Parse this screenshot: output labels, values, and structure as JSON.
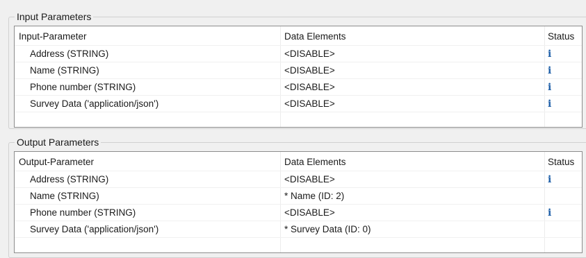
{
  "input_section": {
    "title": "Input Parameters",
    "headers": {
      "param": "Input-Parameter",
      "data": "Data Elements",
      "status": "Status"
    },
    "rows": [
      {
        "param": "Address (STRING)",
        "data": "<DISABLE>",
        "status": "i"
      },
      {
        "param": "Name (STRING)",
        "data": "<DISABLE>",
        "status": "i"
      },
      {
        "param": "Phone number (STRING)",
        "data": "<DISABLE>",
        "status": "i"
      },
      {
        "param": "Survey Data ('application/json')",
        "data": "<DISABLE>",
        "status": "i"
      }
    ]
  },
  "output_section": {
    "title": "Output Parameters",
    "headers": {
      "param": "Output-Parameter",
      "data": "Data Elements",
      "status": "Status"
    },
    "rows": [
      {
        "param": "Address (STRING)",
        "data": "<DISABLE>",
        "status": "i"
      },
      {
        "param": "Name (STRING)",
        "data": "* Name  (ID: 2)",
        "status": ""
      },
      {
        "param": "Phone number (STRING)",
        "data": "<DISABLE>",
        "status": "i"
      },
      {
        "param": "Survey Data ('application/json')",
        "data": "* Survey Data  (ID: 0)",
        "status": ""
      }
    ]
  },
  "icons": {
    "info": "info-icon"
  },
  "colors": {
    "info_icon": "#2060a8",
    "table_bg": "#ffffff",
    "panel_bg": "#f0f0f0"
  }
}
